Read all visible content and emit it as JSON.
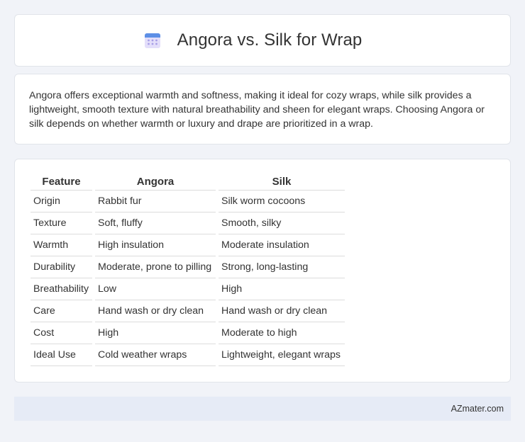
{
  "header": {
    "title": "Angora vs. Silk for Wrap",
    "icon": "calendar-icon"
  },
  "intro": {
    "text": "Angora offers exceptional warmth and softness, making it ideal for cozy wraps, while silk provides a lightweight, smooth texture with natural breathability and sheen for elegant wraps. Choosing Angora or silk depends on whether warmth or luxury and drape are prioritized in a wrap."
  },
  "table": {
    "headers": [
      "Feature",
      "Angora",
      "Silk"
    ],
    "rows": [
      [
        "Origin",
        "Rabbit fur",
        "Silk worm cocoons"
      ],
      [
        "Texture",
        "Soft, fluffy",
        "Smooth, silky"
      ],
      [
        "Warmth",
        "High insulation",
        "Moderate insulation"
      ],
      [
        "Durability",
        "Moderate, prone to pilling",
        "Strong, long-lasting"
      ],
      [
        "Breathability",
        "Low",
        "High"
      ],
      [
        "Care",
        "Hand wash or dry clean",
        "Hand wash or dry clean"
      ],
      [
        "Cost",
        "High",
        "Moderate to high"
      ],
      [
        "Ideal Use",
        "Cold weather wraps",
        "Lightweight, elegant wraps"
      ]
    ]
  },
  "footer": {
    "brand": "AZmater.com"
  }
}
